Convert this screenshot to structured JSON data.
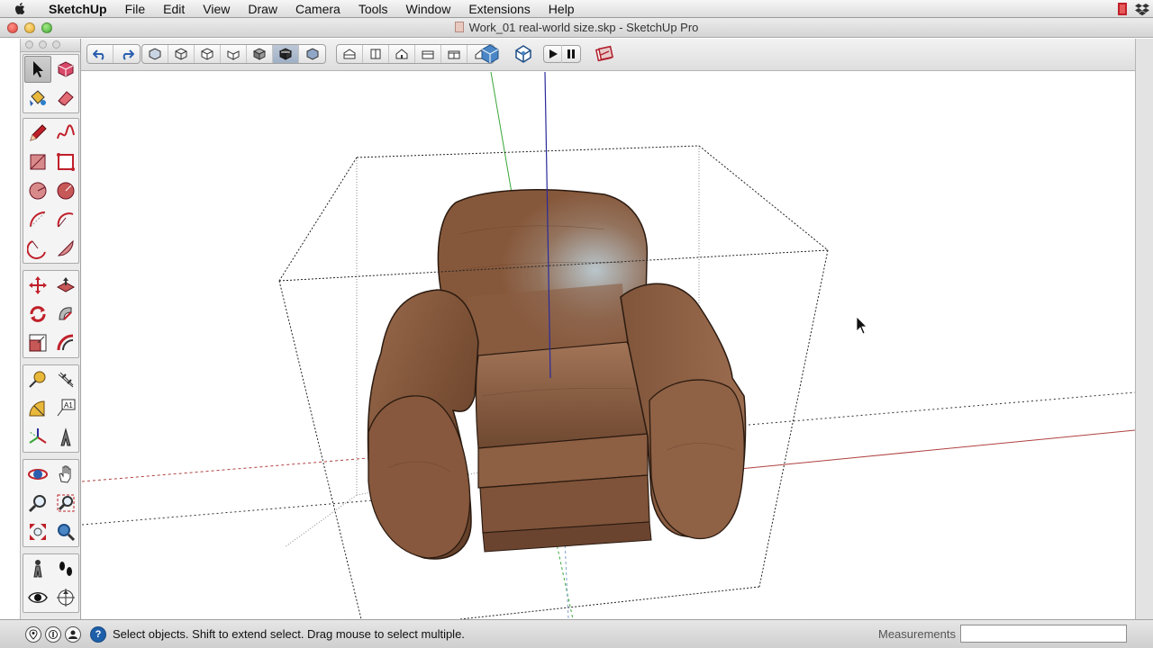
{
  "menubar": {
    "app_name": "SketchUp",
    "items": [
      "File",
      "Edit",
      "View",
      "Draw",
      "Camera",
      "Tools",
      "Window",
      "Extensions",
      "Help"
    ]
  },
  "window": {
    "title": "Work_01 real-world size.skp - SketchUp Pro"
  },
  "toolbar": {
    "undo_icon": "undo-icon",
    "redo_icon": "redo-icon",
    "face_styles": [
      "xray",
      "wireframe",
      "hidden-line",
      "shaded",
      "shaded-textures",
      "monochrome",
      "back-edges"
    ],
    "active_face_style": "monochrome",
    "standard_views": [
      "iso",
      "top",
      "front",
      "right",
      "back",
      "left"
    ],
    "extras": [
      "warehouse",
      "extension-warehouse",
      "play",
      "pause",
      "layout"
    ]
  },
  "palette": {
    "selected_tool": "select"
  },
  "statusbar": {
    "message": "Select objects. Shift to extend select. Drag mouse to select multiple.",
    "measurements_label": "Measurements",
    "measurements_value": ""
  },
  "colors": {
    "accent_active": "#9fb0c5",
    "leather": "#8a5a3e",
    "axis_red": "#b04040",
    "axis_green": "#3aa63a",
    "axis_blue": "#2a2a9a"
  }
}
